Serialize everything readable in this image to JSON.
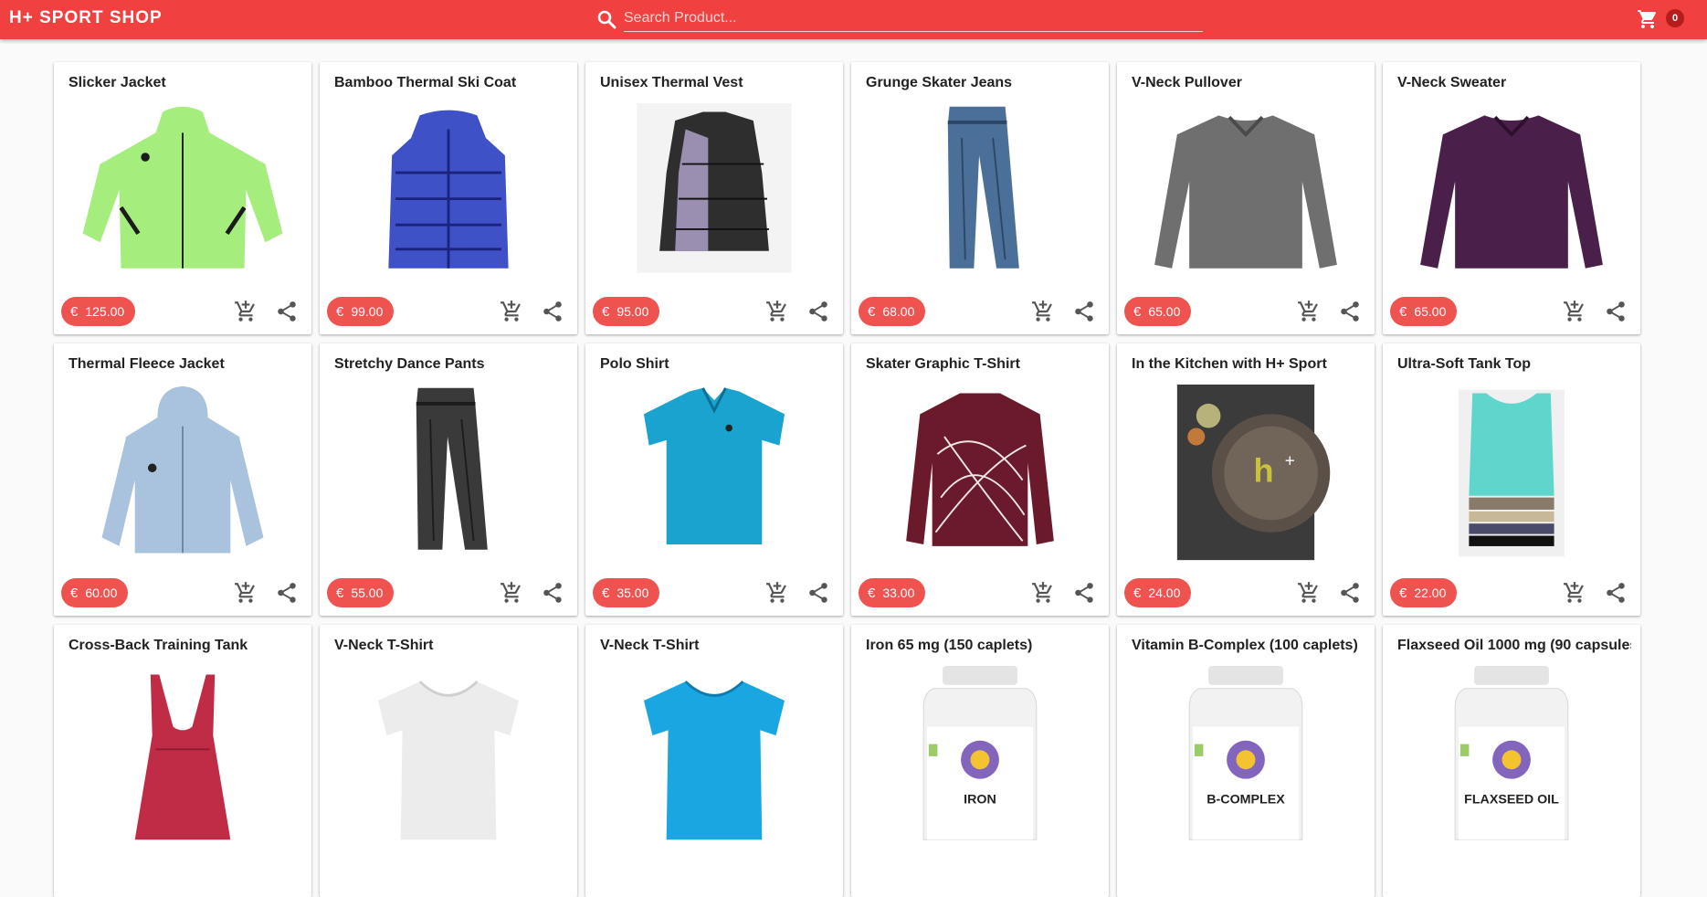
{
  "header": {
    "brand": "H+ SPORT SHOP",
    "search_placeholder": "Search Product...",
    "cart_count": "0",
    "bar_color": "#f04040"
  },
  "currency": "€",
  "icons": {
    "search": "search-icon",
    "cart": "shopping-cart-icon",
    "add_to_cart": "add-shopping-cart-icon",
    "share": "share-icon"
  },
  "products": [
    {
      "name": "Slicker Jacket",
      "price": "125.00",
      "art": "jacket",
      "color": "#a5ee7e",
      "accent": "#1b1b1b"
    },
    {
      "name": "Bamboo Thermal Ski Coat",
      "price": "99.00",
      "art": "puffer",
      "color": "#3f51c6",
      "accent": "#1a237e"
    },
    {
      "name": "Unisex Thermal Vest",
      "price": "95.00",
      "art": "vest",
      "color": "#2e2e2e",
      "accent": "#9a8fb0"
    },
    {
      "name": "Grunge Skater Jeans",
      "price": "68.00",
      "art": "pants",
      "color": "#4a6f99",
      "accent": "#2c4766"
    },
    {
      "name": "V-Neck Pullover",
      "price": "65.00",
      "art": "sweater",
      "color": "#6f6f6f",
      "accent": "#4a4a4a"
    },
    {
      "name": "V-Neck Sweater",
      "price": "65.00",
      "art": "sweater",
      "color": "#4a1f4a",
      "accent": "#2e0f2e"
    },
    {
      "name": "Thermal Fleece Jacket",
      "price": "60.00",
      "art": "hoodie",
      "color": "#a9c3de",
      "accent": "#6c86a3"
    },
    {
      "name": "Stretchy Dance Pants",
      "price": "55.00",
      "art": "pants",
      "color": "#3a3a3a",
      "accent": "#1c1c1c"
    },
    {
      "name": "Polo Shirt",
      "price": "35.00",
      "art": "polo",
      "color": "#1aa3cf",
      "accent": "#0b6f91"
    },
    {
      "name": "Skater Graphic T-Shirt",
      "price": "33.00",
      "art": "longsleeve",
      "color": "#6b1a2b",
      "accent": "#f0e6e6"
    },
    {
      "name": "In the Kitchen with H+ Sport",
      "price": "24.00",
      "art": "book",
      "color": "#3b3b3b",
      "accent": "#c9c23a"
    },
    {
      "name": "Ultra-Soft Tank Top",
      "price": "22.00",
      "art": "tank-stack",
      "color": "#5fd6cb",
      "accent": "#8a7a6a"
    },
    {
      "name": "Cross-Back Training Tank",
      "price": "",
      "art": "tank",
      "color": "#c02c45",
      "accent": "#8a1c2e"
    },
    {
      "name": "V-Neck T-Shirt",
      "price": "",
      "art": "tee",
      "color": "#ececec",
      "accent": "#cfcfcf"
    },
    {
      "name": "V-Neck T-Shirt",
      "price": "",
      "art": "tee",
      "color": "#1aa6e0",
      "accent": "#0d7bb0"
    },
    {
      "name": "Iron 65 mg (150 caplets)",
      "price": "",
      "art": "bottle",
      "label": "IRON",
      "color": "#f2f2f2",
      "accent": "#6d4ab3"
    },
    {
      "name": "Vitamin B-Complex (100 caplets)",
      "price": "",
      "art": "bottle",
      "label": "B-COMPLEX",
      "color": "#f2f2f2",
      "accent": "#6d4ab3"
    },
    {
      "name": "Flaxseed Oil 1000 mg (90 capsules",
      "price": "",
      "art": "bottle",
      "label": "FLAXSEED OIL",
      "color": "#f2f2f2",
      "accent": "#6d4ab3"
    }
  ]
}
